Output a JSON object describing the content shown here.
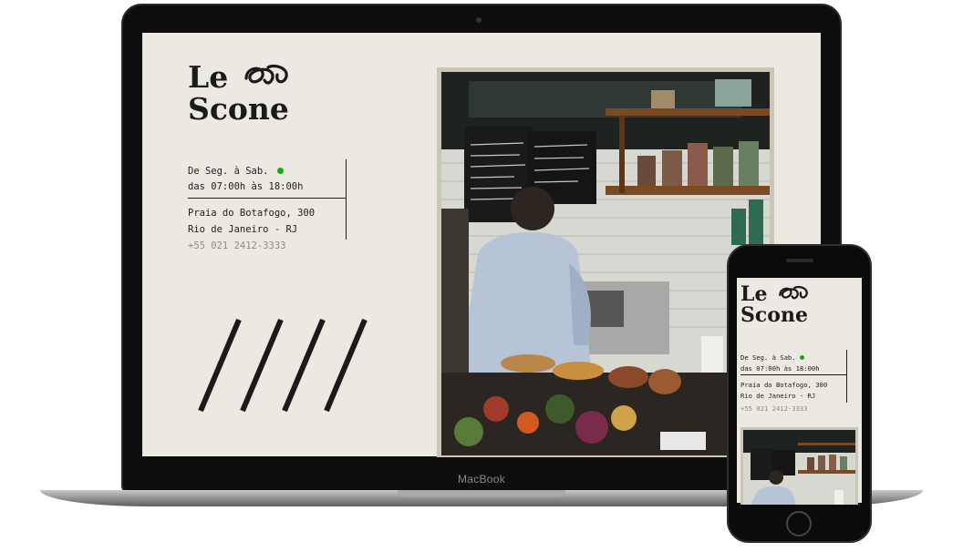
{
  "site": {
    "logo_line1": "Le",
    "logo_swirl": "ꝏ",
    "logo_line2": "Scone",
    "hours_days": "De Seg. à Sab.",
    "hours_time": "das 07:00h às 18:00h",
    "address_street": "Praia do Botafogo, 300",
    "address_city": "Rio de Janeiro - RJ",
    "phone": "+55 021 2412-3333",
    "open_status_color": "#17a817",
    "background_color": "#ebe9e2"
  },
  "device": {
    "laptop_label": "MacBook"
  },
  "photo": {
    "description_icon": "cafe-photo"
  }
}
